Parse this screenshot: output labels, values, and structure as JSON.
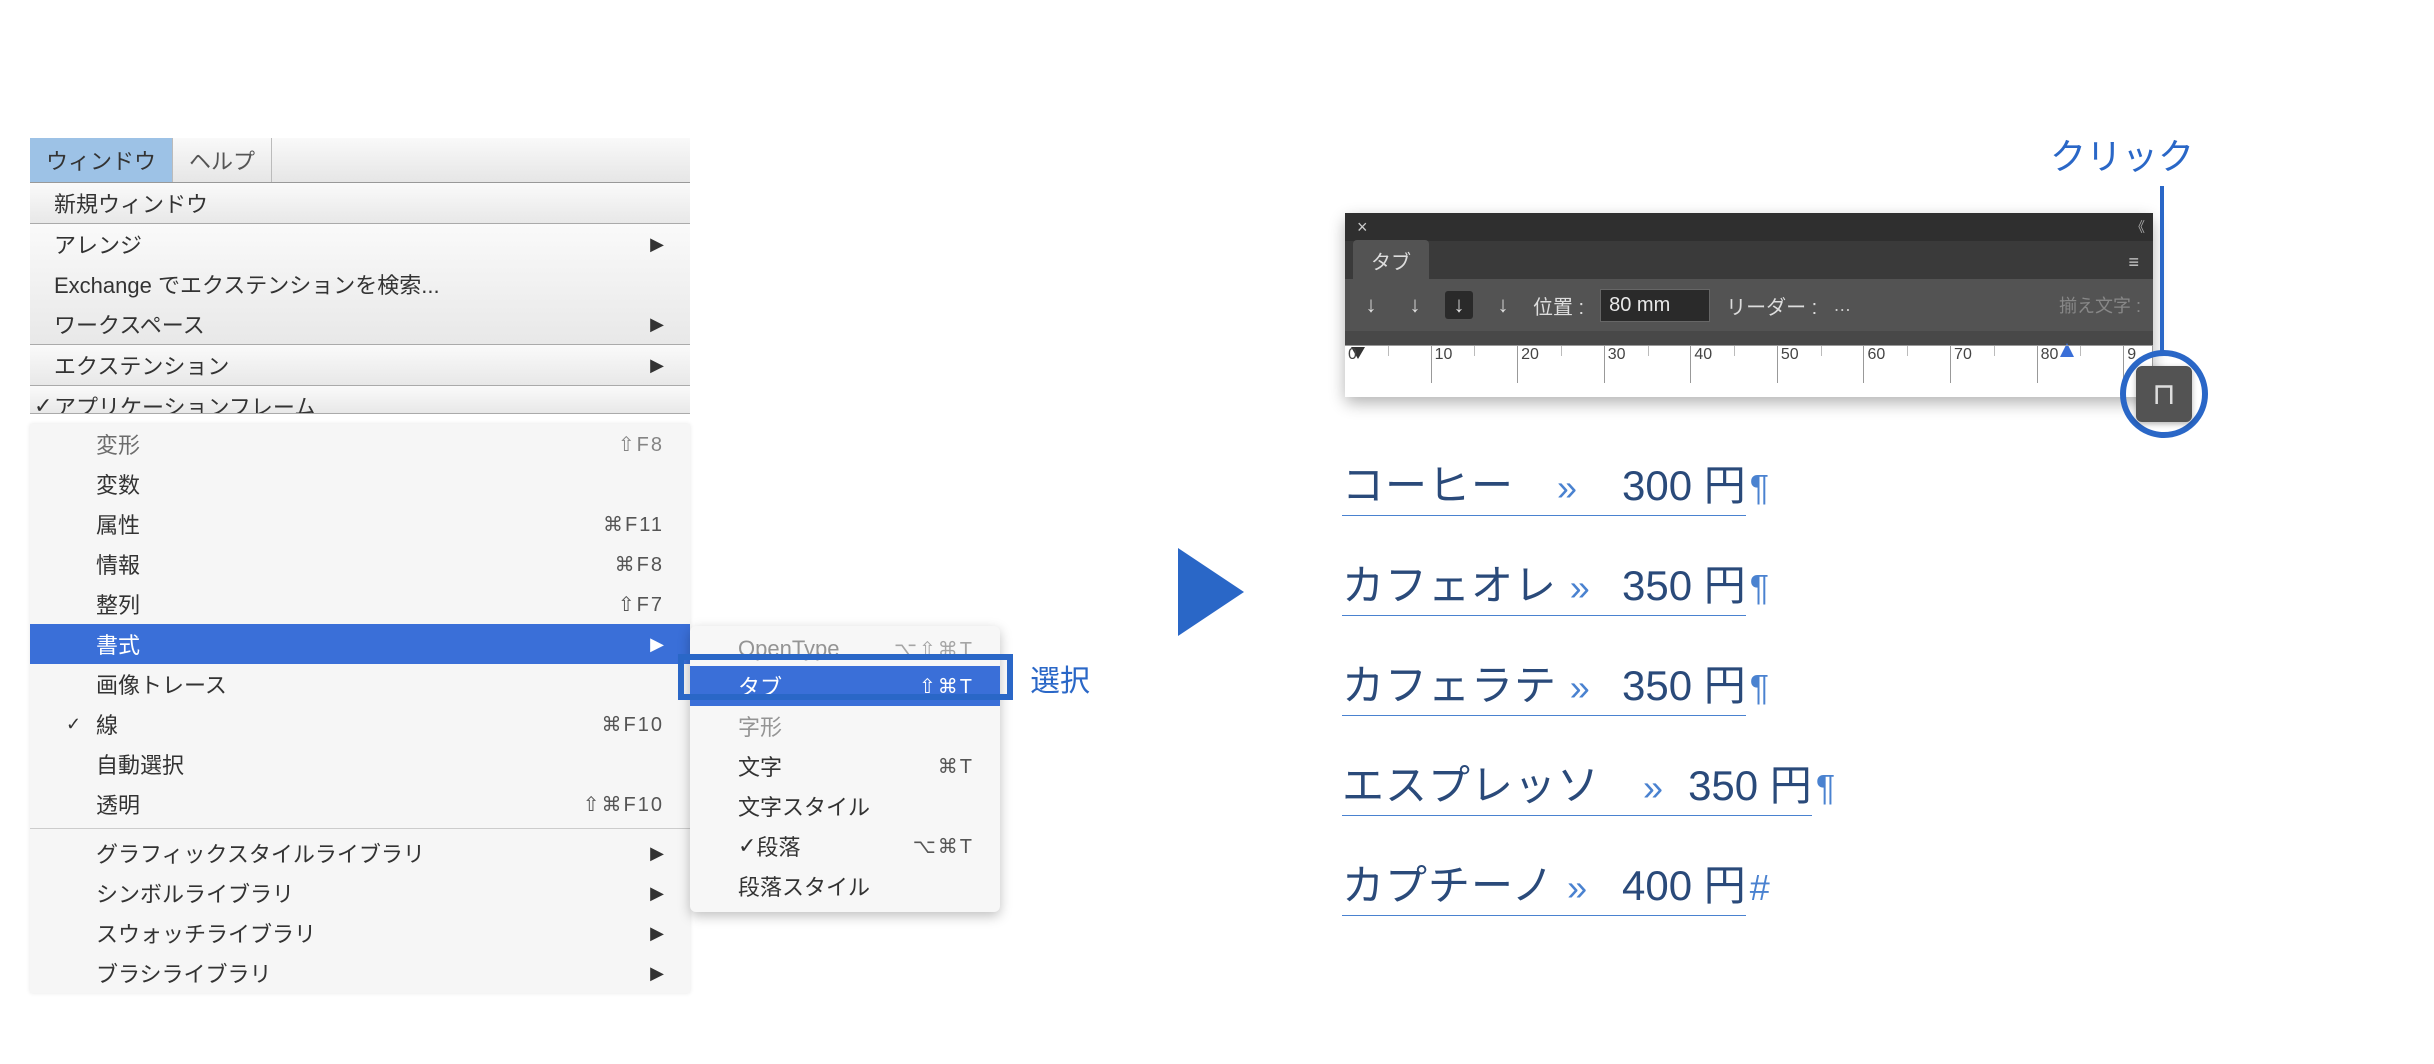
{
  "menubar": {
    "active": "ウィンドウ",
    "other": "ヘルプ"
  },
  "menu1": {
    "new_window": "新規ウィンドウ",
    "arrange": "アレンジ",
    "exchange": "Exchange でエクステンションを検索...",
    "workspace": "ワークスペース",
    "extension": "エクステンション",
    "app_frame": "アプリケーションフレーム"
  },
  "menu2": {
    "transform": "変形",
    "transform_sc": "⇧F8",
    "vars": "変数",
    "attrib": "属性",
    "attrib_sc": "⌘F11",
    "info": "情報",
    "info_sc": "⌘F8",
    "align": "整列",
    "align_sc": "⇧F7",
    "format": "書式",
    "image_trace": "画像トレース",
    "line": "線",
    "line_sc": "⌘F10",
    "auto_select": "自動選択",
    "transparent": "透明",
    "transparent_sc": "⇧⌘F10",
    "gfx_style": "グラフィックスタイルライブラリ",
    "symbol_lib": "シンボルライブラリ",
    "swatch_lib": "スウォッチライブラリ",
    "brush_lib": "ブラシライブラリ"
  },
  "submenu": {
    "opentype": "OpenType",
    "opentype_sc": "⌥⇧⌘T",
    "tab": "タブ",
    "tab_sc": "⇧⌘T",
    "glyph_alt": "字形",
    "moji": "文字",
    "moji_sc": "⌘T",
    "moji_style": "文字スタイル",
    "para": "段落",
    "para_sc": "⌥⌘T",
    "para_style": "段落スタイル"
  },
  "labels": {
    "select": "選択",
    "click": "クリック"
  },
  "panel": {
    "tab": "タブ",
    "pos_label": "位置 :",
    "pos_value": "80 mm",
    "leader_label": "リーダー :",
    "align_char_label": "揃え文字 :",
    "ruler_ticks": [
      "0",
      "10",
      "20",
      "30",
      "40",
      "50",
      "60",
      "70",
      "80",
      "9"
    ]
  },
  "text_lines": [
    {
      "name": "コーヒー",
      "price": "300 円",
      "end": "¶"
    },
    {
      "name": "カフェオレ",
      "price": "350 円",
      "end": "¶"
    },
    {
      "name": "カフェラテ",
      "price": "350 円",
      "end": "¶"
    },
    {
      "name": "エスプレッソ",
      "price": "350 円",
      "end": "¶"
    },
    {
      "name": "カプチーノ",
      "price": "400 円",
      "end": "#"
    }
  ]
}
